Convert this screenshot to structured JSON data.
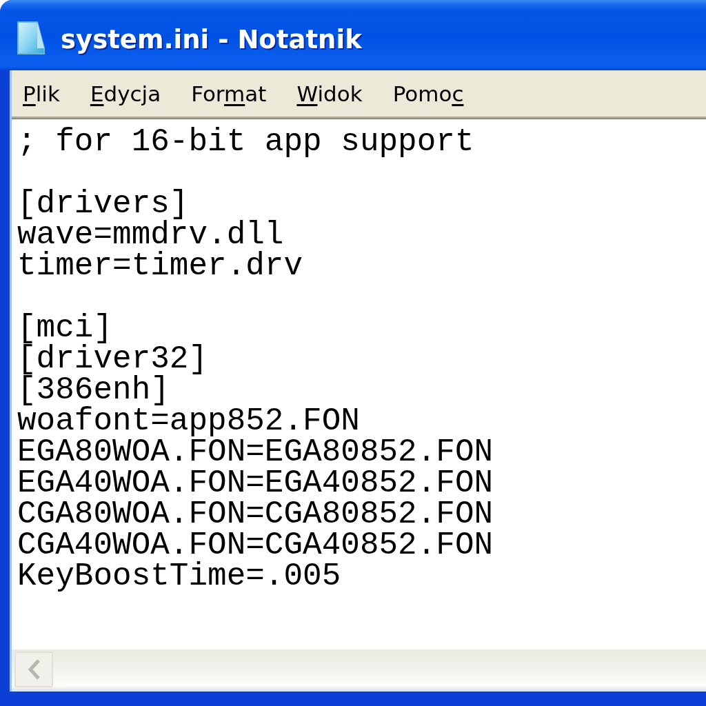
{
  "window": {
    "title": "system.ini - Notatnik"
  },
  "menu": [
    {
      "label_parts": [
        {
          "text": "P",
          "access_key": true
        },
        {
          "text": "lik",
          "access_key": false
        }
      ]
    },
    {
      "label_parts": [
        {
          "text": "E",
          "access_key": true
        },
        {
          "text": "dycja",
          "access_key": false
        }
      ]
    },
    {
      "label_parts": [
        {
          "text": "For",
          "access_key": false
        },
        {
          "text": "m",
          "access_key": true
        },
        {
          "text": "at",
          "access_key": false
        }
      ]
    },
    {
      "label_parts": [
        {
          "text": "W",
          "access_key": true
        },
        {
          "text": "idok",
          "access_key": false
        }
      ]
    },
    {
      "label_parts": [
        {
          "text": "Pomo",
          "access_key": false
        },
        {
          "text": "c",
          "access_key": true
        }
      ]
    }
  ],
  "editor": {
    "blocks": [
      [
        "; for 16-bit app support"
      ],
      [
        "[drivers]",
        "wave=mmdrv.dll",
        "timer=timer.drv"
      ],
      [
        "[mci]",
        "[driver32]",
        "[386enh]",
        "woafont=app852.FON",
        "EGA80WOA.FON=EGA80852.FON",
        "EGA40WOA.FON=EGA40852.FON",
        "CGA80WOA.FON=CGA80852.FON",
        "CGA40WOA.FON=CGA40852.FON",
        "KeyBoostTime=.005"
      ]
    ]
  }
}
